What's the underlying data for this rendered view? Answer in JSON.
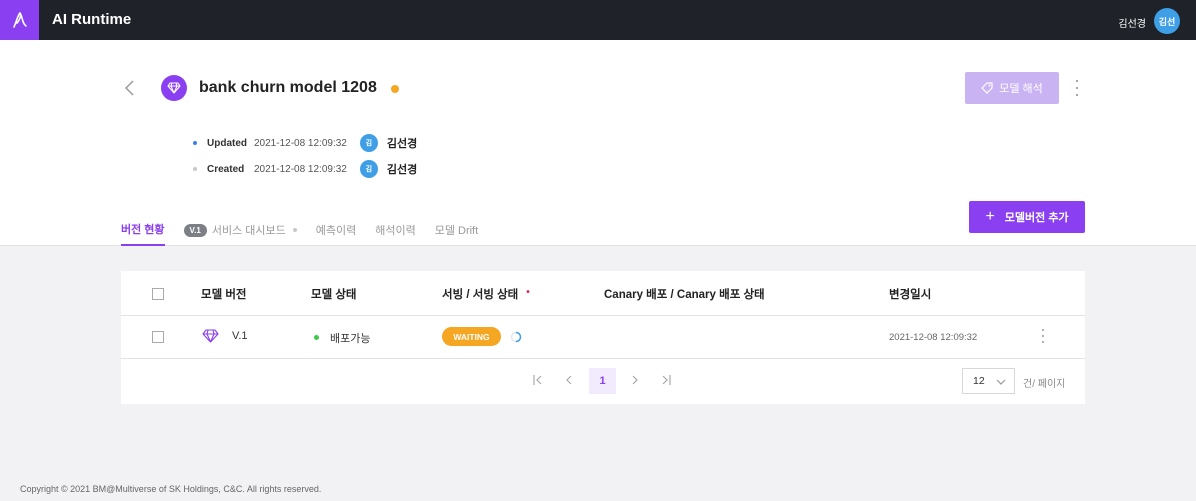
{
  "app": {
    "title": "AI Runtime",
    "logo_icon": "runtime-logo-icon"
  },
  "user": {
    "name": "김선경",
    "avatar_text": "김선"
  },
  "model": {
    "title": "bank churn model 1208",
    "status_color": "#f5a623",
    "analyze_button": "모델 해석",
    "updated": {
      "label": "Updated",
      "date": "2021-12-08 12:09:32",
      "avatar_text": "김",
      "user": "김선경"
    },
    "created": {
      "label": "Created",
      "date": "2021-12-08 12:09:32",
      "avatar_text": "김",
      "user": "김선경"
    }
  },
  "tabs": [
    {
      "label": "버전 현황",
      "active": true
    },
    {
      "badge": "V.1",
      "label": "서비스 대시보드"
    },
    {
      "label": "예측이력"
    },
    {
      "label": "해석이력"
    },
    {
      "label": "모델 Drift"
    }
  ],
  "add_version_button": "모델버전 추가",
  "table": {
    "headers": {
      "version": "모델 버전",
      "model_status": "모델 상태",
      "serving": "서빙 / 서빙 상태",
      "serving_marker": "•",
      "canary": "Canary 배포 / Canary 배포 상태",
      "updated_at": "변경일시"
    },
    "rows": [
      {
        "version": "V.1",
        "model_status": "배포가능",
        "serving_status": "WAITING",
        "updated_at": "2021-12-08 12:09:32"
      }
    ]
  },
  "pagination": {
    "current_page": "1",
    "page_size": "12",
    "unit_label": "건/ 페이지"
  },
  "footer": {
    "copyright": "Copyright © 2021 BM@Multiverse of SK Holdings, C&C. All rights reserved."
  },
  "colors": {
    "accent": "#8a3ff0",
    "topbar": "#1f2229",
    "waiting": "#f5a623",
    "deployable": "#3ec94b",
    "avatar": "#3e9ee6"
  }
}
